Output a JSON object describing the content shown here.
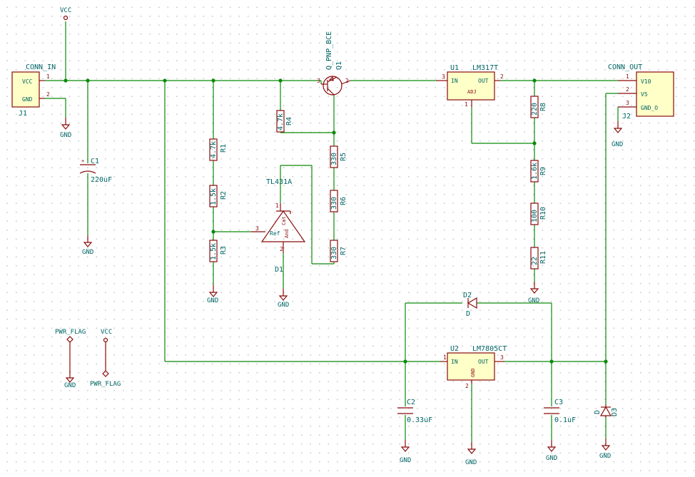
{
  "connectors": {
    "conn_in": {
      "name": "CONN_IN",
      "ref": "J1",
      "pins": [
        "VCC",
        "GND"
      ],
      "pin_numbers": [
        "1",
        "2"
      ]
    },
    "conn_out": {
      "name": "CONN_OUT",
      "ref": "J2",
      "pins": [
        "V10",
        "V5",
        "GND_O"
      ],
      "pin_numbers": [
        "1",
        "2",
        "3"
      ]
    }
  },
  "regulators": {
    "u1": {
      "ref": "U1",
      "value": "LM317T",
      "in": "IN",
      "out": "OUT",
      "adj": "ADJ",
      "pin_in": "3",
      "pin_out": "2",
      "pin_adj": "1"
    },
    "u2": {
      "ref": "U2",
      "value": "LM7805CT",
      "in": "IN",
      "out": "OUT",
      "gnd": "GND",
      "pin_in": "1",
      "pin_out": "3",
      "pin_gnd": "2"
    }
  },
  "transistor": {
    "ref": "Q1",
    "value": "Q_PNP_BCE",
    "pin_b": "3",
    "pin_c": "2"
  },
  "shunt": {
    "ref": "D1",
    "value": "TL431A",
    "ref_pin": "Ref",
    "cat": "Cat",
    "and": "And",
    "pin_ref": "3",
    "pin_cat": "1",
    "pin_and": "2"
  },
  "resistors": [
    {
      "ref": "R1",
      "value": "4.7k"
    },
    {
      "ref": "R2",
      "value": "1.5k"
    },
    {
      "ref": "R3",
      "value": "1.5k"
    },
    {
      "ref": "R4",
      "value": "4.7k"
    },
    {
      "ref": "R5",
      "value": "330"
    },
    {
      "ref": "R6",
      "value": "330"
    },
    {
      "ref": "R7",
      "value": "330"
    },
    {
      "ref": "R8",
      "value": "220"
    },
    {
      "ref": "R9",
      "value": "1.6k"
    },
    {
      "ref": "R10",
      "value": "100"
    },
    {
      "ref": "R11",
      "value": "22"
    }
  ],
  "capacitors": [
    {
      "ref": "C1",
      "value": "220uF"
    },
    {
      "ref": "C2",
      "value": "0.33uF"
    },
    {
      "ref": "C3",
      "value": "0.1uF"
    }
  ],
  "diodes": [
    {
      "ref": "D2",
      "value": "D"
    },
    {
      "ref": "D3",
      "value": "D"
    }
  ],
  "power": {
    "vcc": "VCC",
    "gnd": "GND",
    "pwr_flag": "PWR_FLAG",
    "pin_one": "1"
  }
}
